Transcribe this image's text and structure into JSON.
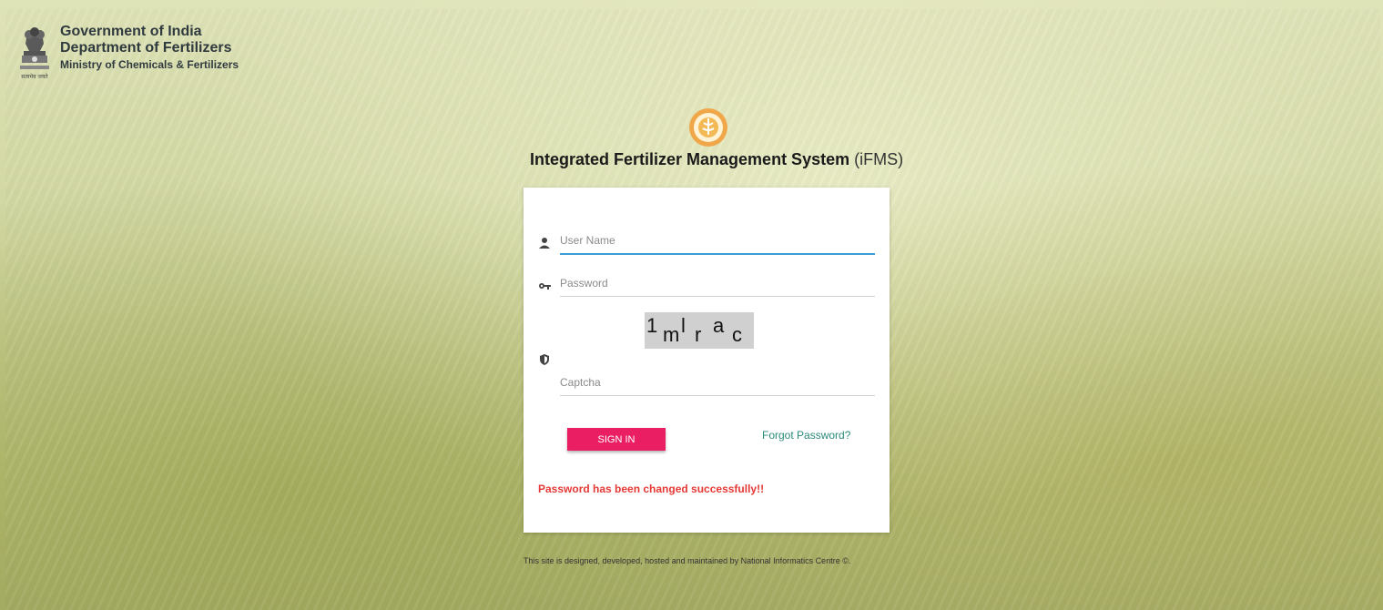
{
  "header": {
    "line1": "Government of India",
    "line2": "Department of Fertilizers",
    "line3": "Ministry of Chemicals & Fertilizers",
    "emblem_caption": "सत्यमेव जयते"
  },
  "app": {
    "title": "Integrated Fertilizer Management System",
    "abbr": "(iFMS)"
  },
  "form": {
    "username": {
      "placeholder": "User Name",
      "value": ""
    },
    "password": {
      "placeholder": "Password",
      "value": ""
    },
    "captcha_image": {
      "text": [
        "1",
        "m",
        "l",
        "r",
        "a",
        "c"
      ]
    },
    "captcha_input": {
      "placeholder": "Captcha",
      "value": ""
    },
    "signin_label": "SIGN IN",
    "forgot_label": "Forgot Password?",
    "message": "Password has been changed successfully!!"
  },
  "footer": {
    "text": "This site is designed, developed, hosted and maintained by National Informatics Centre ©."
  },
  "icons": {
    "user": "person-icon",
    "password": "key-icon",
    "captcha": "shield-icon"
  },
  "colors": {
    "primary_button": "#e91e63",
    "link": "#2a8a79",
    "message": "#e53935",
    "active_underline": "#3d9bd6"
  }
}
